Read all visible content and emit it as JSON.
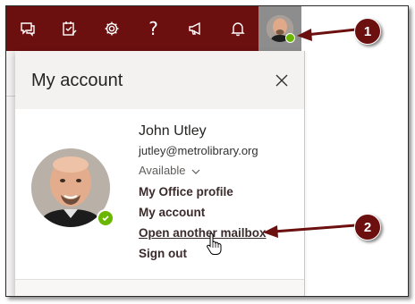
{
  "toolbar": {
    "icons": [
      "chat-icon",
      "tasks-icon",
      "gear-icon",
      "help-icon",
      "megaphone-icon",
      "bell-icon"
    ],
    "help_glyph": "?"
  },
  "panel": {
    "title": "My account",
    "user": {
      "name": "John Utley",
      "email": "jutley@metrolibrary.org",
      "status": "Available"
    },
    "links": {
      "office_profile": "My Office profile",
      "my_account": "My account",
      "open_mailbox": "Open another mailbox",
      "sign_out": "Sign out"
    }
  },
  "callouts": {
    "one": "1",
    "two": "2"
  },
  "colors": {
    "topbar": "#6b0f0f",
    "presence": "#6bb700",
    "callout": "#6b0f0f"
  }
}
